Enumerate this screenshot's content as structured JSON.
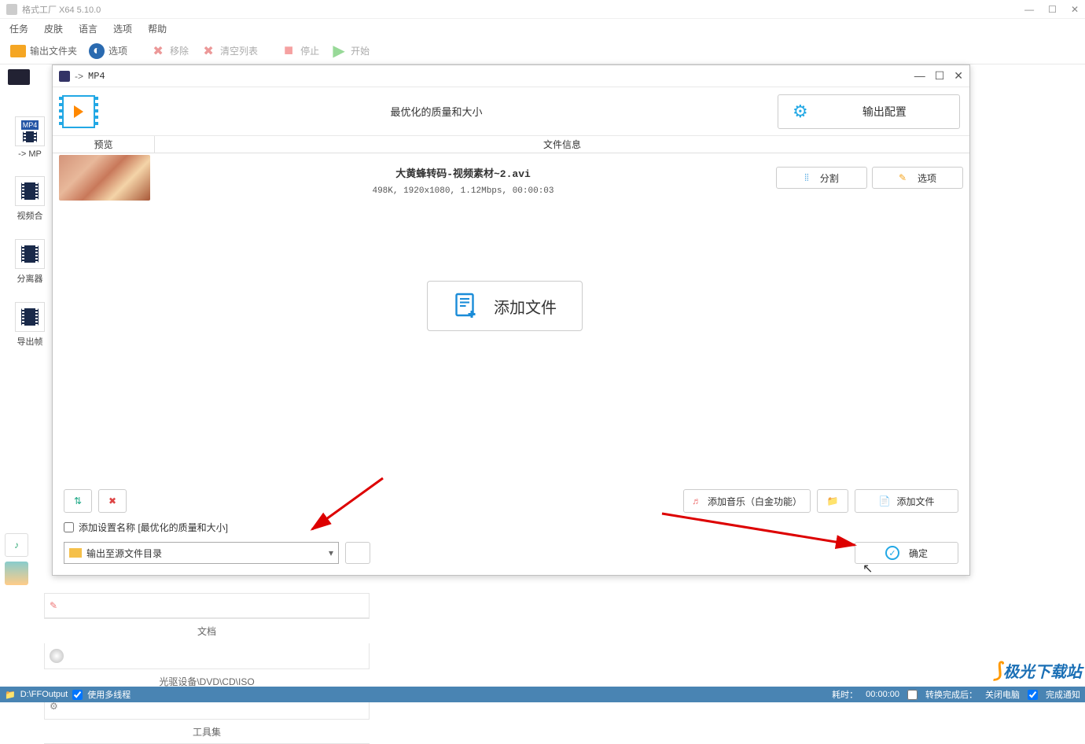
{
  "window": {
    "title": "格式工厂 X64 5.10.0"
  },
  "menu": {
    "task": "任务",
    "skin": "皮肤",
    "lang": "语言",
    "option": "选项",
    "help": "帮助"
  },
  "toolbar": {
    "output_folder": "输出文件夹",
    "options": "选项",
    "remove": "移除",
    "clear": "清空列表",
    "stop": "停止",
    "start": "开始"
  },
  "sidebar": {
    "mp4_arrow": "-> MP",
    "video_merge": "视频合",
    "separator": "分离器",
    "export_frame": "导出帧"
  },
  "bottom_bars": {
    "doc": "文档",
    "disc": "光驱设备\\DVD\\CD\\ISO",
    "tools": "工具集"
  },
  "statusbar": {
    "output_path": "D:\\FFOutput",
    "multithread": "使用多线程",
    "elapsed_label": "耗时：",
    "elapsed_value": "00:00:00",
    "after_label": "转换完成后：",
    "after_value": "关闭电脑",
    "notify": "完成通知"
  },
  "dialog": {
    "title_arrow": "->",
    "title_format": "MP4",
    "quality_label": "最优化的质量和大小",
    "output_config": "输出配置",
    "col_preview": "预览",
    "col_fileinfo": "文件信息",
    "file": {
      "name": "大黄蜂转码-视频素材~2.avi",
      "meta": "498K, 1920x1080, 1.12Mbps, 00:00:03"
    },
    "split_btn": "分割",
    "option_btn": "选项",
    "add_file_big": "添加文件",
    "add_music": "添加音乐（白金功能）",
    "add_file_small": "添加文件",
    "append_name_label": "添加设置名称 [最优化的质量和大小]",
    "output_dir": "输出至源文件目录",
    "ok": "确定"
  },
  "watermark": "极光下载站"
}
